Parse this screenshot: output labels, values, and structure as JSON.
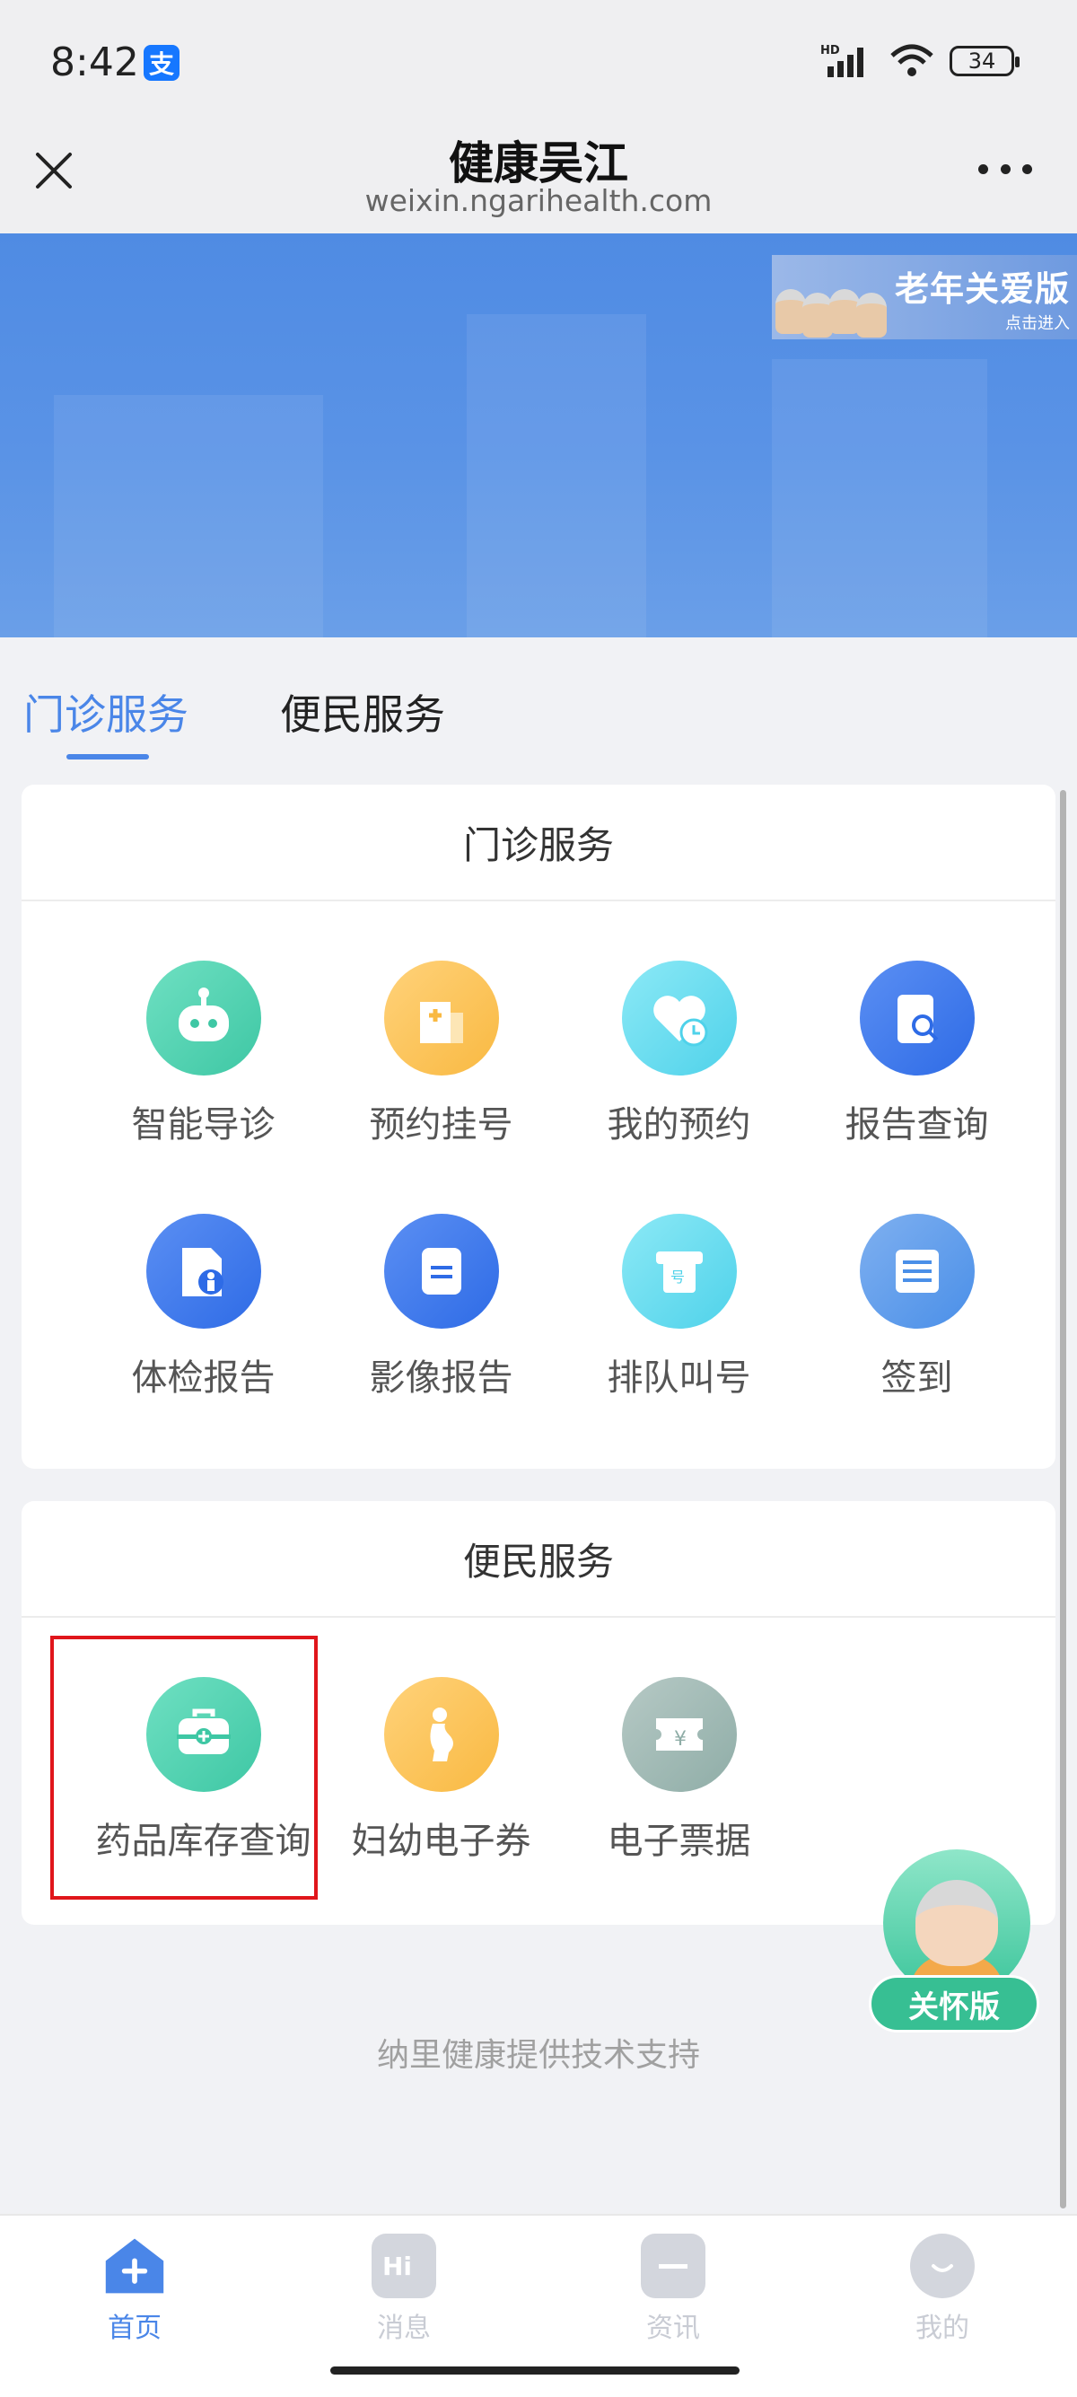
{
  "status_bar": {
    "time": "8:42",
    "alipay_glyph": "支",
    "network": "HD",
    "battery": "34"
  },
  "nav": {
    "title": "健康吴江",
    "subtitle": "weixin.ngarihealth.com"
  },
  "banner": {
    "elder_title": "老年关爱版",
    "elder_sub": "点击进入"
  },
  "tabs": [
    {
      "label": "门诊服务",
      "active": true
    },
    {
      "label": "便民服务",
      "active": false
    }
  ],
  "outpatient": {
    "title": "门诊服务",
    "items": [
      {
        "label": "智能导诊",
        "icon": "robot-icon",
        "color": "#3ec7a4"
      },
      {
        "label": "预约挂号",
        "icon": "register-icon",
        "color": "#f9b942"
      },
      {
        "label": "我的预约",
        "icon": "heart-clock-icon",
        "color": "#4fd2ea"
      },
      {
        "label": "报告查询",
        "icon": "report-search-icon",
        "color": "#2e6be6"
      },
      {
        "label": "体检报告",
        "icon": "checkup-report-icon",
        "color": "#2e6be6"
      },
      {
        "label": "影像报告",
        "icon": "image-report-icon",
        "color": "#2e6be6"
      },
      {
        "label": "排队叫号",
        "icon": "queue-ticket-icon",
        "color": "#4fd2ea"
      },
      {
        "label": "签到",
        "icon": "checkin-icon",
        "color": "#4a8fe8"
      }
    ]
  },
  "convenience": {
    "title": "便民服务",
    "items": [
      {
        "label": "药品库存查询",
        "icon": "medicine-box-icon",
        "color": "#3ec7a4"
      },
      {
        "label": "妇幼电子券",
        "icon": "maternal-icon",
        "color": "#f9b942"
      },
      {
        "label": "电子票据",
        "icon": "receipt-icon",
        "color": "#8fada7"
      }
    ]
  },
  "care_button": {
    "label": "关怀版"
  },
  "footer": {
    "powered_by": "纳里健康提供技术支持"
  },
  "tabbar": [
    {
      "label": "首页",
      "icon": "home-plus-icon",
      "active": true
    },
    {
      "label": "消息",
      "icon": "message-hi-icon",
      "active": false
    },
    {
      "label": "资讯",
      "icon": "news-icon",
      "active": false
    },
    {
      "label": "我的",
      "icon": "profile-icon",
      "active": false
    }
  ],
  "colors": {
    "accent": "#4a86e8",
    "highlight": "#e0161b",
    "care_green": "#37bf93"
  }
}
